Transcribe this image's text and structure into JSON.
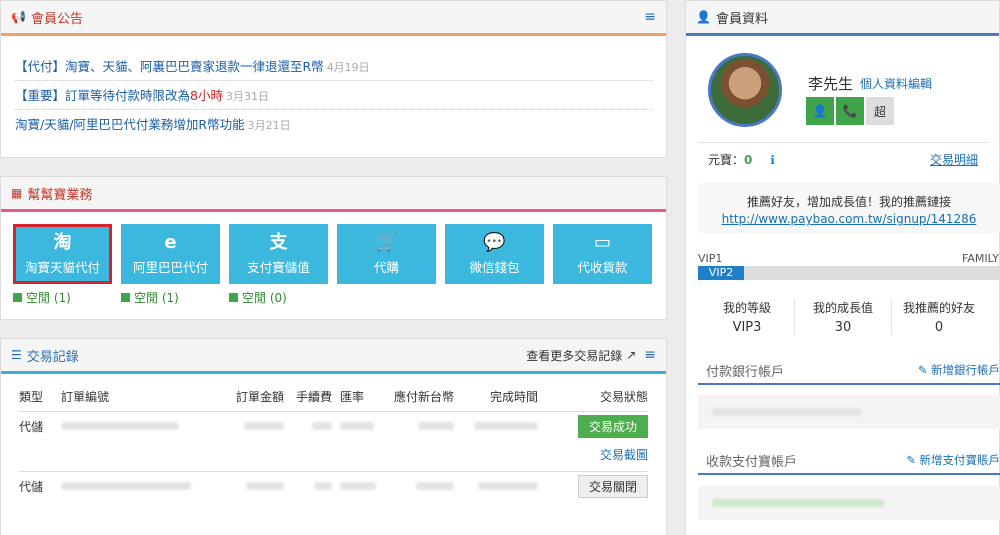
{
  "announce": {
    "title": "會員公告",
    "items": [
      {
        "text": "【代付】淘寶、天貓、阿裏巴巴賣家退款一律退還至R幣",
        "date": "4月19日"
      },
      {
        "prefix": "【重要】訂單等待付款時限改為",
        "red": "8小時",
        "date": "3月31日"
      },
      {
        "text": "淘寶/天貓/阿里巴巴代付業務增加R幣功能",
        "date": "3月21日"
      }
    ]
  },
  "business": {
    "title": "幫幫寶業務",
    "tiles": [
      {
        "icon": "淘",
        "label": "淘寶天貓代付"
      },
      {
        "icon": "e",
        "label": "阿里巴巴代付"
      },
      {
        "icon": "支",
        "label": "支付寶儲值"
      },
      {
        "icon": "🛒",
        "label": "代購"
      },
      {
        "icon": "💬",
        "label": "微信錢包"
      },
      {
        "icon": "▭",
        "label": "代收貨款"
      }
    ],
    "statuses": [
      "空閒 (1)",
      "空閒 (1)",
      "空閒 (0)"
    ]
  },
  "transactions": {
    "title": "交易記錄",
    "more": "查看更多交易記錄",
    "headers": [
      "類型",
      "訂單編號",
      "訂單金額",
      "手續費",
      "匯率",
      "應付新台幣",
      "完成時間",
      "交易狀態"
    ],
    "rows": [
      {
        "type": "代儲",
        "status": "交易成功",
        "link": "交易截圖"
      },
      {
        "type": "代儲",
        "status": "交易關閉"
      }
    ]
  },
  "member": {
    "title": "會員資料",
    "name": "李先生",
    "edit": "個人資料編輯",
    "super_label": "超",
    "balance_label": "元寶：",
    "balance_value": "0",
    "balance_link": "交易明細",
    "refer_text": "推薦好友，增加成長值！我的推薦鏈接",
    "refer_url": "http://www.paybao.com.tw/signup/141286",
    "vip_left": "VIP1",
    "vip_right": "FAMILY",
    "vip_current": "VIP2",
    "stats": [
      {
        "label": "我的等級",
        "value": "VIP3"
      },
      {
        "label": "我的成長值",
        "value": "30"
      },
      {
        "label": "我推薦的好友",
        "value": "0"
      }
    ],
    "bank_title": "付款銀行帳戶",
    "bank_add": "新增銀行帳戶",
    "alipay_title": "收款支付寶帳戶",
    "alipay_add": "新增支付寶賬戶"
  }
}
